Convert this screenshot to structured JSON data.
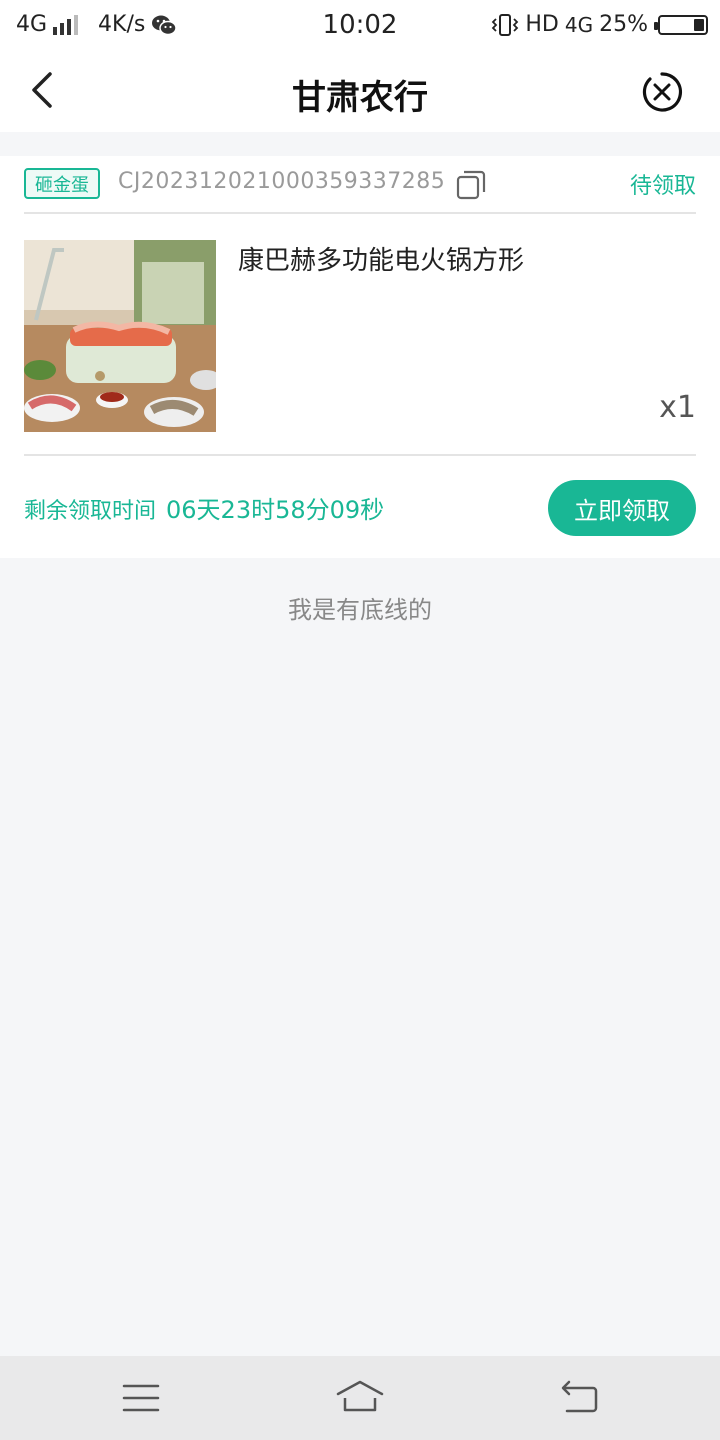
{
  "status_bar": {
    "network_left": "4G",
    "speed": "4K/s",
    "time": "10:02",
    "hd": "HD",
    "network_right": "4G",
    "battery": "25%"
  },
  "nav": {
    "title": "甘肃农行"
  },
  "order": {
    "tag": "砸金蛋",
    "order_no": "CJ20231202100035933728​5",
    "status": "待领取",
    "product_name": "康巴赫多功能电火锅方形",
    "quantity": "x1",
    "timer_label": "剩余领取时间",
    "timer_value": "06天23时58分09秒",
    "claim_button": "立即领取"
  },
  "footer_note": "我是有底线的",
  "colors": {
    "accent": "#19b795",
    "background": "#f5f6f8"
  }
}
